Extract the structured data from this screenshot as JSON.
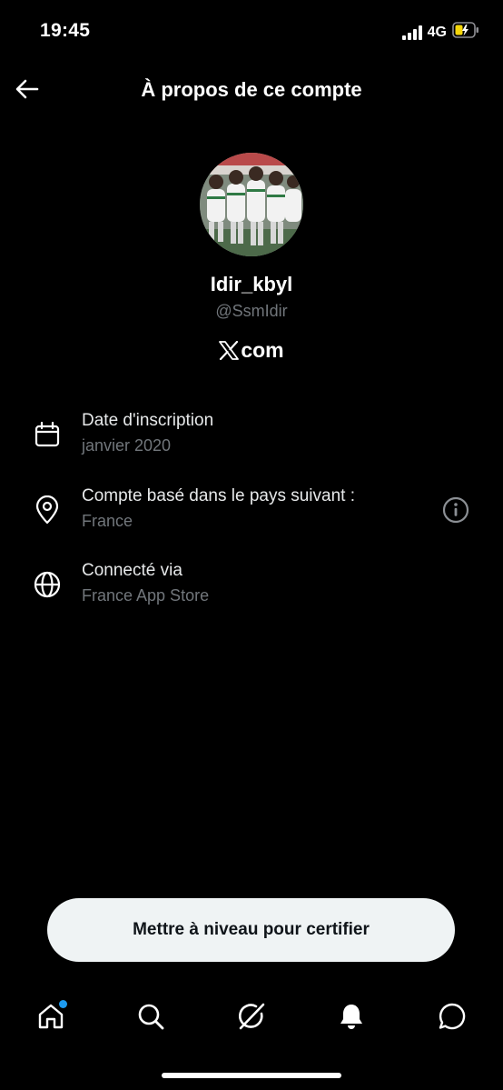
{
  "status_bar": {
    "time": "19:45",
    "network": "4G",
    "battery_color": "#f5d60a"
  },
  "header": {
    "title": "À propos de ce compte"
  },
  "profile": {
    "display_name": "Idir_kbyl",
    "handle": "@SsmIdir",
    "platform_badge": "com",
    "platform_logo": "x-logo"
  },
  "info_rows": [
    {
      "icon": "calendar-icon",
      "title": "Date d'inscription",
      "value": "janvier 2020"
    },
    {
      "icon": "location-pin-icon",
      "title": "Compte basé dans le pays suivant :",
      "value": "France",
      "detail_icon": "info-icon"
    },
    {
      "icon": "globe-icon",
      "title": "Connecté via",
      "value": "France App Store"
    }
  ],
  "upgrade_button": {
    "label": "Mettre à niveau pour certifier"
  },
  "bottom_nav": {
    "items": [
      "home-icon",
      "search-icon",
      "grok-icon",
      "notifications-icon",
      "messages-icon"
    ],
    "home_badge_color": "#1d9bf0"
  },
  "colors": {
    "background": "#000000",
    "text_primary": "#ffffff",
    "text_secondary": "#71767b",
    "button_bg": "#eff3f4",
    "accent": "#1d9bf0"
  }
}
